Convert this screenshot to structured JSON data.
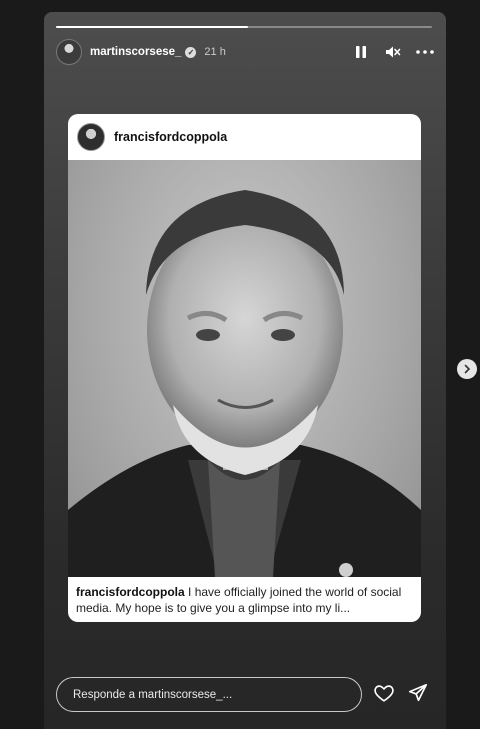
{
  "story": {
    "progress_fraction": 0.51,
    "author": {
      "username": "martinscorsese_",
      "verified": true,
      "time_ago": "21 h"
    },
    "controls": {
      "pause": "pause-icon",
      "mute": "muted-speaker-icon",
      "more": "more-options-icon"
    }
  },
  "post": {
    "username": "francisfordcoppola",
    "caption_user": "francisfordcoppola",
    "caption_text": " I have officially joined the world of social media. My hope is to give you a glimpse into my li..."
  },
  "reply": {
    "placeholder": "Responde a martinscorsese_..."
  },
  "navigation": {
    "next_icon": "chevron-right-icon"
  },
  "colors": {
    "background": "#1a1a1a",
    "card": "#ffffff",
    "text_primary": "#ffffff"
  }
}
